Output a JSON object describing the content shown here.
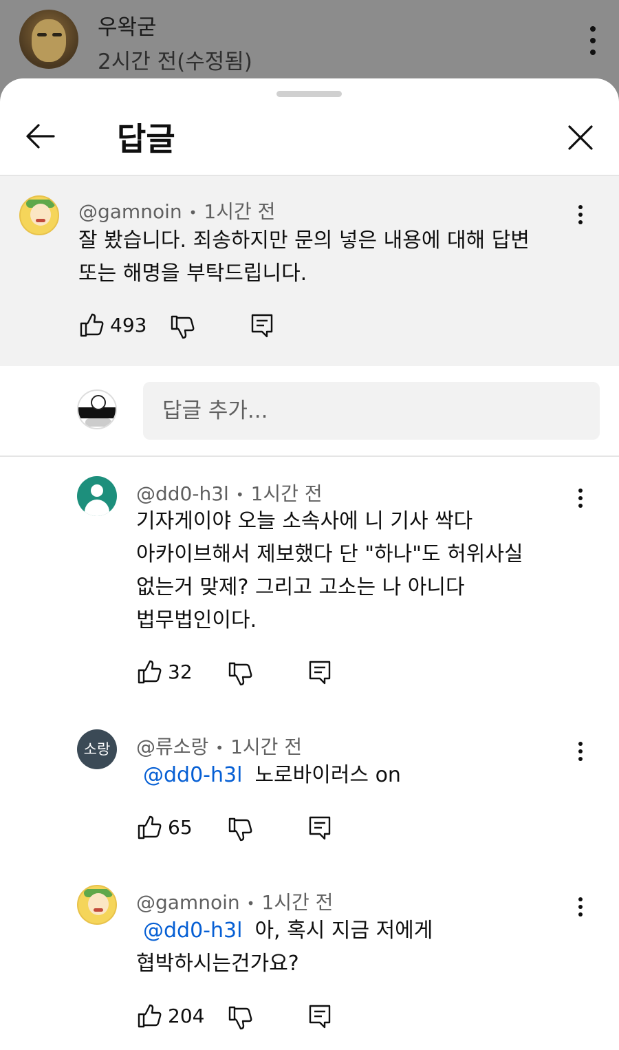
{
  "background_post": {
    "author": "우왁굳",
    "time": "2시간 전(수정됨)"
  },
  "sheet": {
    "title": "답글"
  },
  "parent_comment": {
    "handle": "@gamnoin",
    "time": "1시간 전",
    "lines": [
      "잘 봤습니다. 죄송하지만 문의 넣은 내용에 대해 답변",
      "또는 해명을 부탁드립니다."
    ],
    "likes": "493"
  },
  "reply_input": {
    "placeholder": "답글 추가..."
  },
  "replies": [
    {
      "handle": "@dd0-h3l",
      "time": "1시간 전",
      "mention": "",
      "lines": [
        "기자게이야 오늘 소속사에 니 기사 싹다",
        "아카이브해서 제보했다 단 \"하나\"도 허위사실",
        "없는거 맞제? 그리고 고소는 나 아니다",
        "법무법인이다."
      ],
      "likes": "32"
    },
    {
      "handle": "@류소랑",
      "avatar_text": "소랑",
      "time": "1시간 전",
      "mention": "@dd0-h3l",
      "lines": [
        "노로바이러스 on"
      ],
      "likes": "65"
    },
    {
      "handle": "@gamnoin",
      "time": "1시간 전",
      "mention": "@dd0-h3l",
      "lines": [
        "아, 혹시 지금 저에게",
        "협박하시는건가요?"
      ],
      "likes": "204"
    }
  ]
}
